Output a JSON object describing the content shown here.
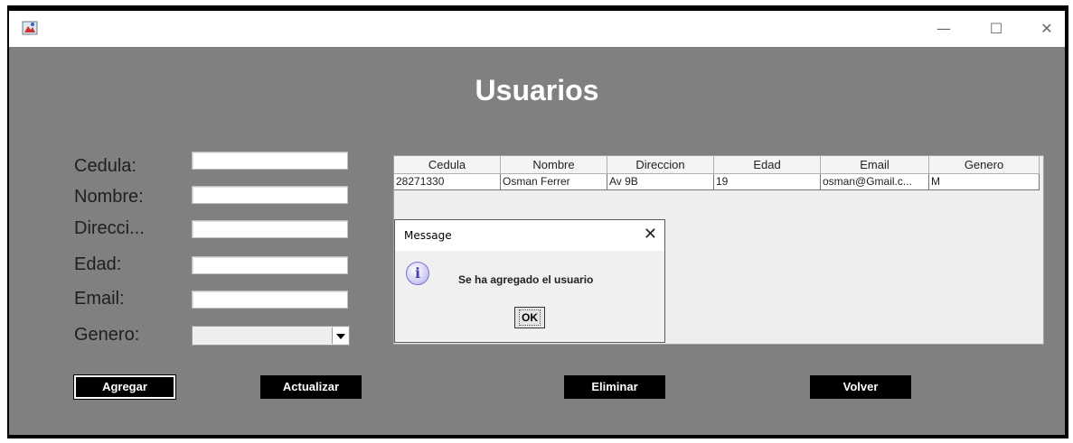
{
  "window": {
    "icon": "java-app-icon",
    "controls": {
      "minimize": "—",
      "maximize": "☐",
      "close": "✕"
    }
  },
  "page": {
    "title": "Usuarios"
  },
  "form": {
    "labels": [
      "Cedula:",
      "Nombre:",
      "Direcci...",
      "Edad:",
      "Email:",
      "Genero:"
    ],
    "values": {
      "cedula": "",
      "nombre": "",
      "direccion": "",
      "edad": "",
      "email": ""
    },
    "genero_selected": ""
  },
  "table": {
    "columns": [
      "Cedula",
      "Nombre",
      "Direccion",
      "Edad",
      "Email",
      "Genero"
    ],
    "rows": [
      [
        "28271330",
        "Osman Ferrer",
        "Av 9B",
        "19",
        "osman@Gmail.c...",
        "M"
      ]
    ]
  },
  "buttons": {
    "agregar": "Agregar",
    "actualizar": "Actualizar",
    "eliminar": "Eliminar",
    "volver": "Volver"
  },
  "dialog": {
    "title": "Message",
    "message": "Se ha agregado el usuario",
    "ok": "OK",
    "icon": "information-icon"
  },
  "colors": {
    "background": "#808080",
    "button": "#000000",
    "title": "#ffffff"
  }
}
